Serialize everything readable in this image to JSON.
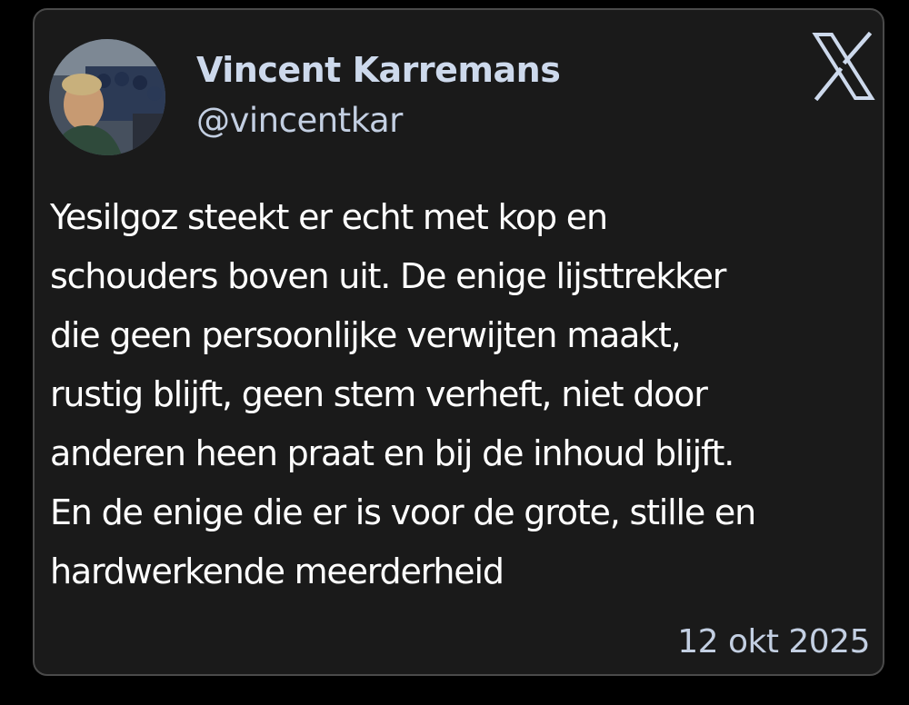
{
  "colors": {
    "background": "#000000",
    "card": "#1a1a1a",
    "card_border": "#4a4a4a",
    "author_name": "#cdd9ec",
    "secondary_text": "#c3cfe2",
    "body_text": "#ffffff"
  },
  "author": {
    "name": "Vincent Karremans",
    "handle": "@vincentkar",
    "avatar_icon": "profile-photo"
  },
  "brand": {
    "logo_icon": "x-logo-icon"
  },
  "tweet": {
    "lines": [
      "Yesilgoz steekt er echt met kop en",
      "schouders boven uit. De enige lijsttrekker",
      "die geen persoonlijke verwijten maakt,",
      "rustig blijft, geen stem verheft, niet door",
      "anderen heen praat en bij de inhoud blijft.",
      "En de enige die er is voor de grote, stille en",
      "hardwerkende meerderheid"
    ],
    "date": "12 okt 2025"
  }
}
